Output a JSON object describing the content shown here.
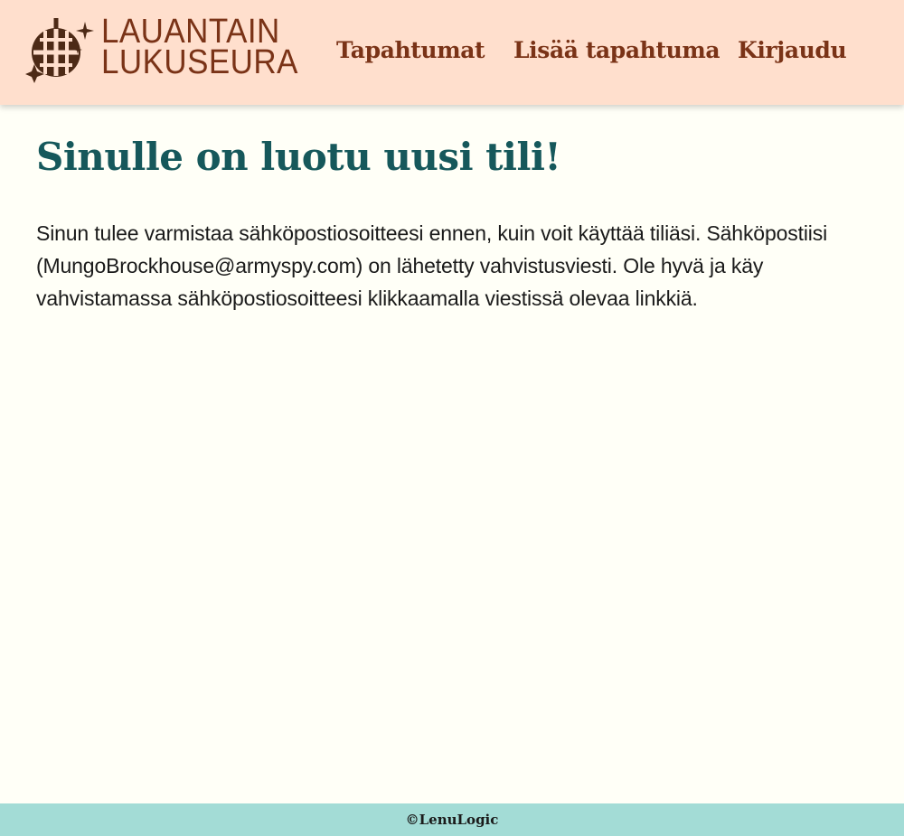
{
  "header": {
    "logo": {
      "line1": "LAUANTAIN",
      "line2": "LUKUSEURA",
      "icon": "disco-ball-icon"
    },
    "nav": [
      {
        "label": "Tapahtumat"
      },
      {
        "label": "Lisää tapahtuma"
      },
      {
        "label": "Kirjaudu"
      }
    ]
  },
  "main": {
    "title": "Sinulle on luotu uusi tili!",
    "message": "Sinun tulee varmistaa sähköpostiosoitteesi ennen, kuin voit käyttää tiliäsi. Sähköpostiisi (MungoBrockhouse@armyspy.com) on lähetetty vahvistusviesti. Ole hyvä ja käy vahvistamassa sähköpostiosoitteesi klikkaamalla viestissä olevaa linkkiä."
  },
  "footer": {
    "text": "©LenuLogic"
  },
  "colors": {
    "header_bg": "#ffdfcd",
    "brand": "#7a3317",
    "title": "#16585b",
    "page_bg": "#fffff7",
    "footer_bg": "#a3dcd6"
  }
}
